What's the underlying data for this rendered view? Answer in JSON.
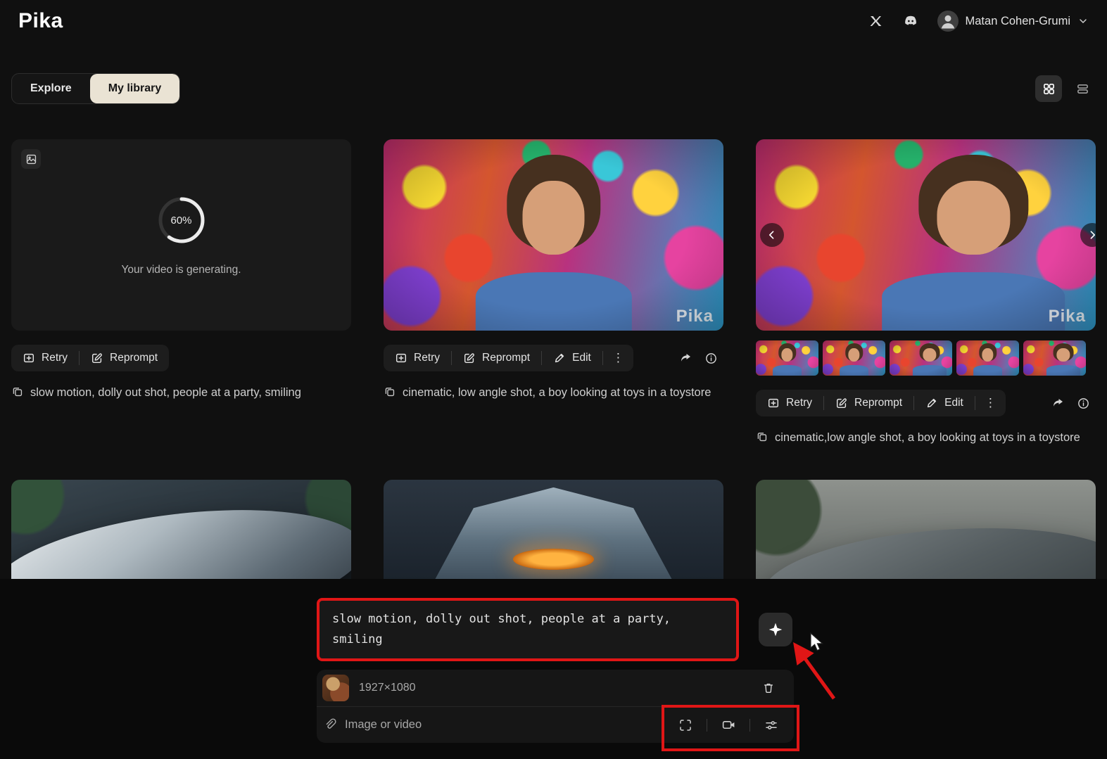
{
  "header": {
    "logo": "Pika",
    "user_name": "Matan Cohen-Grumi"
  },
  "tabs": {
    "explore": "Explore",
    "my_library": "My library"
  },
  "actions": {
    "retry": "Retry",
    "reprompt": "Reprompt",
    "edit": "Edit"
  },
  "icons": {
    "kebab": "⋮"
  },
  "watermark": "Pika",
  "generation": {
    "percent": 60,
    "percent_label": "60%",
    "status": "Your video is generating."
  },
  "cards": [
    {
      "prompt": "slow motion, dolly out shot, people at a party, smiling"
    },
    {
      "prompt": "cinematic, low angle shot, a boy looking at toys in a toystore"
    },
    {
      "prompt": "cinematic,low angle shot, a boy looking at toys in a toystore"
    }
  ],
  "composer": {
    "prompt": "slow motion, dolly out shot, people at a party, smiling",
    "resolution": "1927×1080",
    "attach_label": "Image or video"
  },
  "colors": {
    "annotation_red": "#e01616",
    "selected_tab_bg": "#eae3d4"
  }
}
